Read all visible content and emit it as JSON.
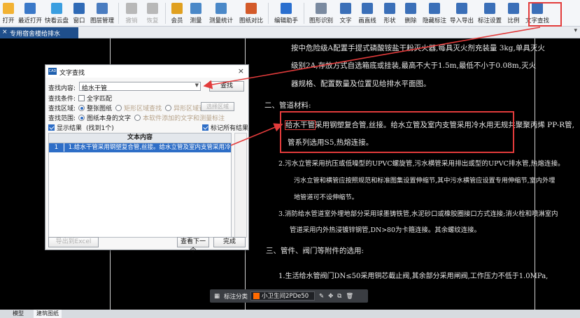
{
  "toolbar": {
    "buttons": [
      {
        "label": "打开",
        "icon": "folder-icon",
        "color": "#f2b233"
      },
      {
        "label": "最近打开",
        "icon": "recent-icon",
        "color": "#3a78c8"
      },
      {
        "label": "快看云盘",
        "icon": "cloud-icon",
        "color": "#3a9ee0"
      },
      {
        "label": "窗口",
        "icon": "window-icon",
        "color": "#2f6ab6"
      },
      {
        "label": "图层管理",
        "icon": "layers-icon",
        "color": "#4a7cc0"
      },
      {
        "label": "撤销",
        "icon": "undo-icon",
        "color": "#b8b8b8",
        "disabled": true
      },
      {
        "label": "恢复",
        "icon": "redo-icon",
        "color": "#b8b8b8",
        "disabled": true
      },
      {
        "label": "会员",
        "icon": "vip-icon",
        "color": "#e0a020"
      },
      {
        "label": "测量",
        "icon": "measure-icon",
        "color": "#4a88c8"
      },
      {
        "label": "测量统计",
        "icon": "measure-stats-icon",
        "color": "#4a88c8"
      },
      {
        "label": "图纸对比",
        "icon": "compare-icon",
        "color": "#d35a2a"
      },
      {
        "label": "编辑助手",
        "icon": "edit-assistant-icon",
        "color": "#2a6fcf"
      },
      {
        "label": "图形识别",
        "icon": "shape-recognize-icon",
        "color": "#7a8aa0"
      },
      {
        "label": "文字",
        "icon": "text-icon",
        "color": "#3a6fb8"
      },
      {
        "label": "画直线",
        "icon": "line-icon",
        "color": "#3a6fb8"
      },
      {
        "label": "形状",
        "icon": "shape-icon",
        "color": "#3a6fb8"
      },
      {
        "label": "删除",
        "icon": "delete-icon",
        "color": "#3a6fb8"
      },
      {
        "label": "隐藏标注",
        "icon": "hide-annotation-icon",
        "color": "#3a6fb8"
      },
      {
        "label": "导入导出",
        "icon": "import-export-icon",
        "color": "#3a6fb8"
      },
      {
        "label": "标注设置",
        "icon": "annotation-settings-icon",
        "color": "#3a6fb8"
      },
      {
        "label": "比例",
        "icon": "scale-icon",
        "color": "#3a6fb8"
      },
      {
        "label": "文字查找",
        "icon": "text-search-icon",
        "color": "#3a6fb8"
      }
    ]
  },
  "tabs": {
    "doc_tab": "专用宿舍楼给排水",
    "right_icon": "▾"
  },
  "canvas": {
    "lines": [
      "按中危险级A配置手提式磷酸铵盐干粉灭火器,每具灭火剂充装量 3kg,单具灭火",
      "级别2A,存放方式自选箱底或挂装,最高不大于1.5m,最低不小于0.08m,灭火",
      "器规格、配置数量及位置见给排水平面图。",
      "二、管道材料:",
      "采用钢塑复合管,丝接。给水立管及室内支管采用冷水用无规共聚聚丙烯 PP-R管,",
      "管系列选用S5,热熔连接。",
      "2.污水立管采用抗压或低噪型的UPVC螺旋管,污水横管采用排出或型的UPVC排水管,热熔连接。",
      "污水立管和横管应按照规范和标准图集设置伸缩节,其中污水横管应设置专用伸缩节,室内外埋",
      "地管道可不设伸缩节。",
      "3.消防给水管道室外埋地部分采用球墨铸铁管,水泥砂口或橡胶圈接口方式连接;消火栓和喷淋室内",
      "管道采用内外热浸镀锌钢管,DN>80为卡箍连接。其余螺纹连接。",
      "三、管件、阀门等附件的选用:",
      "1.生活给水管阀门DN≤50采用铜芯截止阀,其余部分采用闸阀,工作压力不低于1.0MPa,"
    ],
    "highlight_word": "给水干管"
  },
  "dialog": {
    "title": "文字查找",
    "logo": "CAD",
    "content_label": "查找内容:",
    "content_value": "给水干管",
    "search_button": "查找",
    "condition_label": "查找条件:",
    "full_match": "全字匹配",
    "area_label": "查找区域:",
    "area_options": [
      "整张图纸",
      "矩形区域查找",
      "异形区域查找"
    ],
    "select_area_button": "选择区域",
    "range_label": "查找范围:",
    "range_options": [
      "图纸本身的文字",
      "本软件添加的文字和测量标注"
    ],
    "show_results": "显示结果",
    "found_count": "(找到1个)",
    "mark_all": "标记所有结果",
    "table_header": "文本内容",
    "rows": [
      {
        "num": "1",
        "text": "1.给水干管采用钢塑复合管,丝接。给水立管及室内支管采用冷水…"
      }
    ],
    "export_button": "导出到Excel",
    "next_button": "查看下一个",
    "done_button": "完成"
  },
  "float_toolbar": {
    "label": "标注分类",
    "category": "小卫生间2PDe50",
    "color": "#ff6a00"
  },
  "bottom_tabs": [
    "模型",
    "建筑图纸"
  ],
  "colors": {
    "highlight": "#e23b3b",
    "selection": "#2e6ec7",
    "doc_tab": "#1f4f8c"
  }
}
